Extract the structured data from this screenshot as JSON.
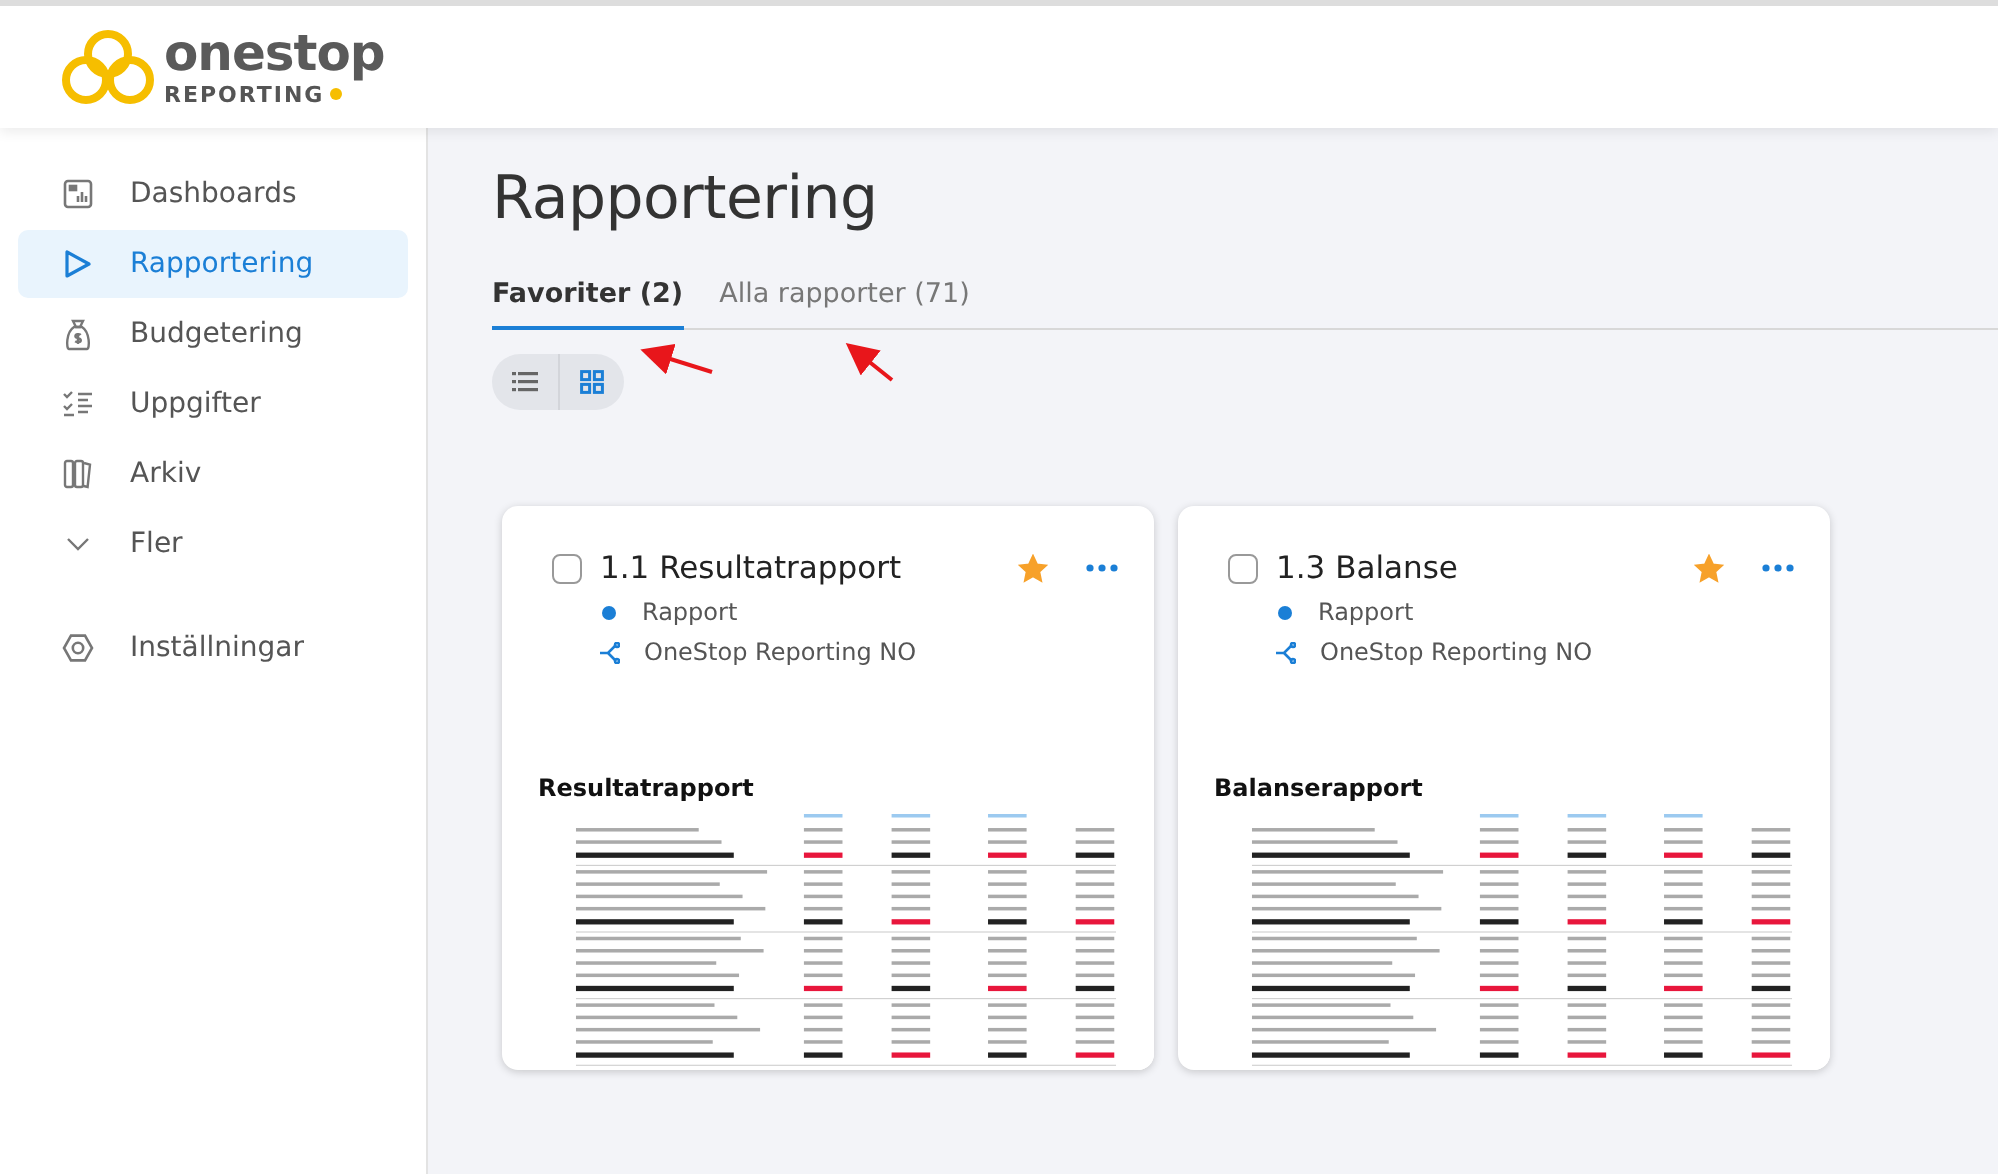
{
  "header": {
    "logo_word": "onestop",
    "logo_sub": "REPORTING"
  },
  "sidebar": {
    "items": [
      {
        "label": "Dashboards",
        "kind": "dashboard",
        "selected": false
      },
      {
        "label": "Rapportering",
        "kind": "reporting",
        "selected": true
      },
      {
        "label": "Budgetering",
        "kind": "budget",
        "selected": false
      },
      {
        "label": "Uppgifter",
        "kind": "tasks",
        "selected": false
      },
      {
        "label": "Arkiv",
        "kind": "archive",
        "selected": false
      },
      {
        "label": "Fler",
        "kind": "more",
        "selected": false,
        "expanded": false
      }
    ],
    "settings": {
      "label": "Inställningar",
      "kind": "settings",
      "selected": false
    }
  },
  "page_title": "Rapportering",
  "tabs": [
    {
      "label": "Favoriter (2)",
      "selected": true
    },
    {
      "label": "Alla rapporter (71)",
      "selected": false
    }
  ],
  "view_toggle": [
    {
      "kind": "list",
      "selected": false
    },
    {
      "kind": "grid",
      "selected": true
    }
  ],
  "cards": [
    {
      "title": "1.1 Resultatrapport",
      "checked": false,
      "favorite": true,
      "type": "Rapport",
      "source": "OneStop Reporting NO",
      "preview_title": "Resultatrapport"
    },
    {
      "title": "1.3 Balanse",
      "checked": false,
      "favorite": true,
      "type": "Rapport",
      "source": "OneStop Reporting NO",
      "preview_title": "Balanserapport"
    }
  ]
}
